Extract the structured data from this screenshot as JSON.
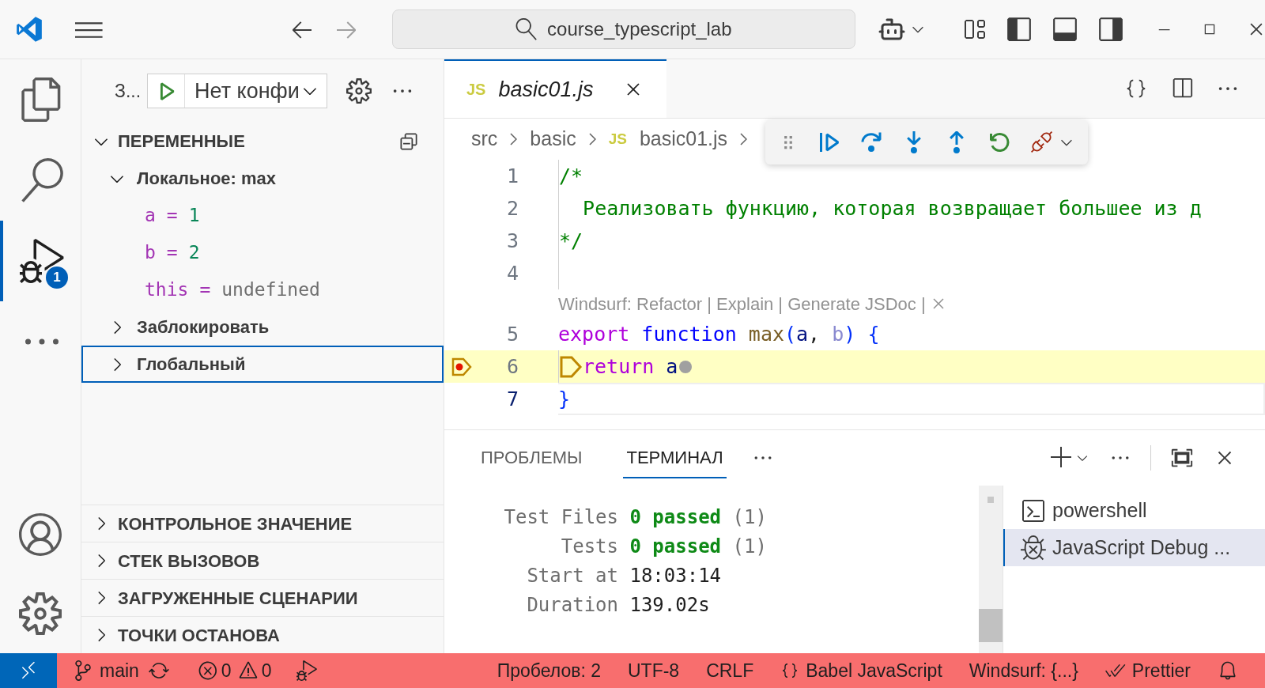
{
  "title_bar": {
    "search": "course_typescript_lab"
  },
  "activity_bar": {
    "items": [
      {
        "kind": "files",
        "selected": false
      },
      {
        "kind": "search",
        "selected": false
      },
      {
        "kind": "debug",
        "selected": true,
        "badge": "1"
      },
      {
        "kind": "more",
        "selected": false
      }
    ],
    "bottom": [
      {
        "kind": "account"
      },
      {
        "kind": "settings"
      }
    ]
  },
  "sidebar": {
    "title": "З...",
    "config": "Нет конфи",
    "variables": {
      "title": "ПЕРЕМЕННЫЕ",
      "expanded": true,
      "scopes": [
        {
          "label": "Локальное: max",
          "expanded": true,
          "selected": false,
          "children": [
            {
              "name": "a",
              "op": "=",
              "value": "1",
              "kind": "number"
            },
            {
              "name": "b",
              "op": "=",
              "value": "2",
              "kind": "number"
            },
            {
              "name": "this",
              "op": "=",
              "value": "undefined",
              "kind": "undefined"
            }
          ]
        },
        {
          "label": "Заблокировать",
          "expanded": false,
          "selected": false
        },
        {
          "label": "Глобальный",
          "expanded": false,
          "selected": true
        }
      ]
    },
    "sections": [
      {
        "title": "КОНТРОЛЬНОЕ ЗНАЧЕНИЕ",
        "expanded": false
      },
      {
        "title": "СТЕК ВЫЗОВОВ",
        "expanded": false
      },
      {
        "title": "ЗАГРУЖЕННЫЕ СЦЕНАРИИ",
        "expanded": false
      },
      {
        "title": "ТОЧКИ ОСТАНОВА",
        "expanded": false
      }
    ]
  },
  "editor": {
    "tab": {
      "badge": "JS",
      "name": "basic01.js",
      "selected": true
    },
    "breadcrumbs": [
      {
        "text": "src"
      },
      {
        "text": "basic"
      },
      {
        "badge": "JS",
        "text": "basic01.js"
      }
    ],
    "lines": [
      {
        "number": "1",
        "tokens": [
          {
            "text": "/*",
            "kind": "comment"
          }
        ]
      },
      {
        "number": "2",
        "tokens": [
          {
            "text": "  Реализовать функцию, которая возвращает большее из д",
            "kind": "comment"
          }
        ]
      },
      {
        "number": "3",
        "tokens": [
          {
            "text": "*/",
            "kind": "comment"
          }
        ]
      },
      {
        "number": "4"
      },
      {
        "kind": "codelens",
        "text": "Windsurf: Refactor | Explain | Generate JSDoc |"
      },
      {
        "number": "5",
        "tokens": [
          {
            "text": "export ",
            "kind": "keyword"
          },
          {
            "text": "function ",
            "kind": "storage"
          },
          {
            "text": "max",
            "kind": "fn"
          },
          {
            "text": "(",
            "kind": "brace"
          },
          {
            "text": "a",
            "kind": "var"
          },
          {
            "text": ", ",
            "kind": "plain"
          },
          {
            "text": "b",
            "kind": "unused"
          },
          {
            "text": ")",
            "kind": "brace"
          },
          {
            "text": " {",
            "kind": "brace"
          }
        ]
      },
      {
        "number": "6",
        "stopped": true,
        "cursor": false,
        "breakpoint": true,
        "tokens": [
          {
            "text": "return ",
            "kind": "keyword"
          },
          {
            "text": "a",
            "kind": "var"
          }
        ]
      },
      {
        "number": "7",
        "stopped": false,
        "cursor": true,
        "breakpoint": false,
        "tokens": [
          {
            "text": "}",
            "kind": "brace"
          }
        ]
      }
    ]
  },
  "panel": {
    "tabs": [
      {
        "label": "ПРОБЛЕМЫ",
        "selected": false
      },
      {
        "label": "ТЕРМИНАЛ",
        "selected": true
      }
    ],
    "terminal": [
      {
        "label": "Test Files",
        "parts": [
          {
            "text": "0 passed",
            "kind": "pass"
          },
          {
            "text": " (1)",
            "kind": "dim"
          }
        ]
      },
      {
        "label": "Tests",
        "parts": [
          {
            "text": "0 passed",
            "kind": "pass"
          },
          {
            "text": " (1)",
            "kind": "dim"
          }
        ]
      },
      {
        "label": "Start at",
        "parts": [
          {
            "text": "18:03:14",
            "kind": "plain"
          }
        ]
      },
      {
        "label": "Duration",
        "parts": [
          {
            "text": "139.02s",
            "kind": "plain"
          }
        ]
      }
    ],
    "terminals": [
      {
        "name": "powershell",
        "kind": "shell",
        "selected": false
      },
      {
        "name": "JavaScript Debug ...",
        "kind": "debug",
        "selected": true
      }
    ]
  },
  "status_bar": {
    "left": [
      {
        "kind": "branch",
        "text": "main"
      },
      {
        "kind": "sync"
      },
      {
        "kind": "problems",
        "errors": "0",
        "warnings": "0"
      },
      {
        "kind": "debug"
      }
    ],
    "right": [
      {
        "kind": "text",
        "text": "Пробелов: 2"
      },
      {
        "kind": "text",
        "text": "UTF-8"
      },
      {
        "kind": "text",
        "text": "CRLF"
      },
      {
        "kind": "language",
        "text": "Babel JavaScript"
      },
      {
        "kind": "text",
        "text": "Windsurf: {...}"
      },
      {
        "kind": "prettier",
        "text": "Prettier"
      },
      {
        "kind": "bell"
      }
    ]
  }
}
